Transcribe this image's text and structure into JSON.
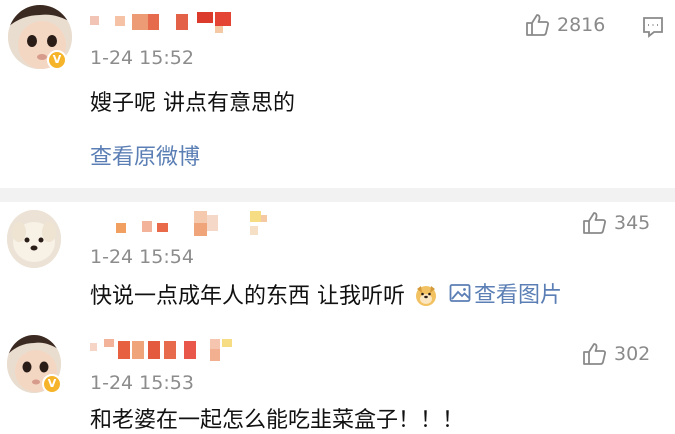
{
  "comments": [
    {
      "time": "1-24 15:52",
      "text": "嫂子呢 讲点有意思的",
      "likes": "2816",
      "view_original": "查看原微博",
      "verified_badge": "v-badge-icon",
      "avatar": "baby-avatar"
    },
    {
      "time": "1-24 15:54",
      "text": "快说一点成年人的东西 让我听听",
      "emoji": "dog-emoji-icon",
      "view_image": "查看图片",
      "likes": "345",
      "avatar": "puppy-avatar"
    },
    {
      "time": "1-24 15:53",
      "text": "和老婆在一起怎么能吃韭菜盒子！！！",
      "likes": "302",
      "verified_badge": "v-badge-icon",
      "avatar": "baby-avatar"
    }
  ],
  "colors": {
    "link": "#5b7fb5",
    "meta_gray": "#8c8c8c",
    "badge_yellow": "#f6b42a",
    "divider_bg": "#f2f2f2",
    "mosaic_red": "#e6503b",
    "mosaic_orange": "#f2a061"
  }
}
